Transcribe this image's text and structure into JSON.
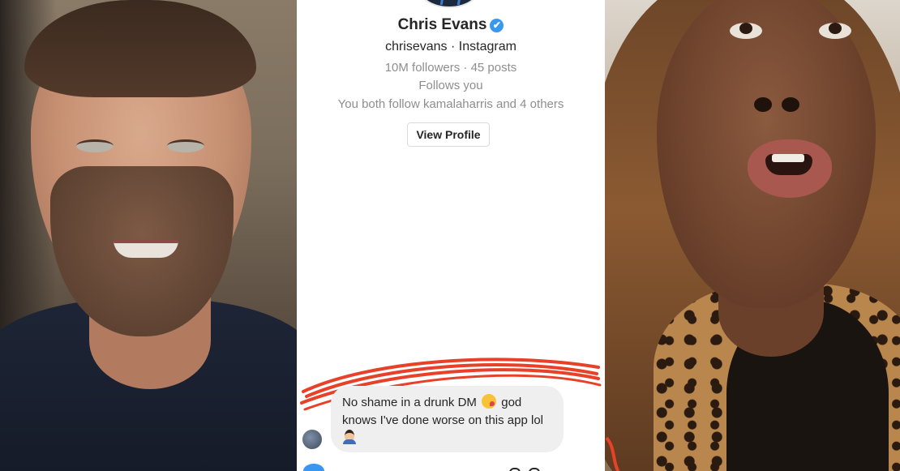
{
  "profile": {
    "name": "Chris Evans",
    "handle_line": "chrisevans · Instagram",
    "stats": "10M followers · 45 posts",
    "follows_you": "Follows you",
    "mutual": "You both follow kamalaharris and 4 others",
    "view_profile_label": "View Profile",
    "verified_icon": "✔"
  },
  "message": {
    "part1": "No shame in a drunk DM ",
    "part2": " god knows I've done worse on this app lol",
    "emoji_1": "winking-face-with-tongue-emoji",
    "emoji_2": "man-technologist-emoji"
  },
  "colors": {
    "verified_blue": "#3897f0",
    "bubble_bg": "#efefef",
    "scribble_red": "#e8412a"
  }
}
